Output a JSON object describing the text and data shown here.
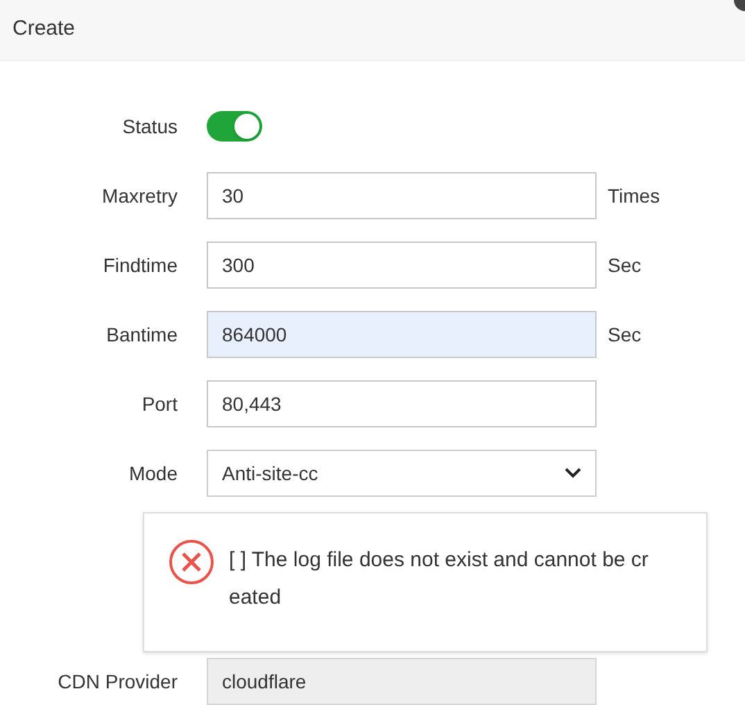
{
  "dialog": {
    "title": "Create"
  },
  "fields": [
    {
      "kind": "switch",
      "label": "Status",
      "on": true
    },
    {
      "kind": "input",
      "label": "Maxretry",
      "value": "30",
      "suffix": "Times",
      "highlighted": false,
      "disabled": false
    },
    {
      "kind": "input",
      "label": "Findtime",
      "value": "300",
      "suffix": "Sec",
      "highlighted": false,
      "disabled": false
    },
    {
      "kind": "input",
      "label": "Bantime",
      "value": "864000",
      "suffix": "Sec",
      "highlighted": true,
      "disabled": false
    },
    {
      "kind": "input",
      "label": "Port",
      "value": "80,443",
      "highlighted": false,
      "disabled": false
    },
    {
      "kind": "select",
      "label": "Mode",
      "value": "Anti-site-cc"
    },
    {
      "kind": "hidden"
    },
    {
      "kind": "hidden"
    },
    {
      "kind": "input",
      "label": "CDN Provider",
      "value": "cloudflare",
      "highlighted": false,
      "disabled": true
    }
  ],
  "alert": {
    "message": "[ ] The log file does not exist and cannot be cr eated"
  }
}
